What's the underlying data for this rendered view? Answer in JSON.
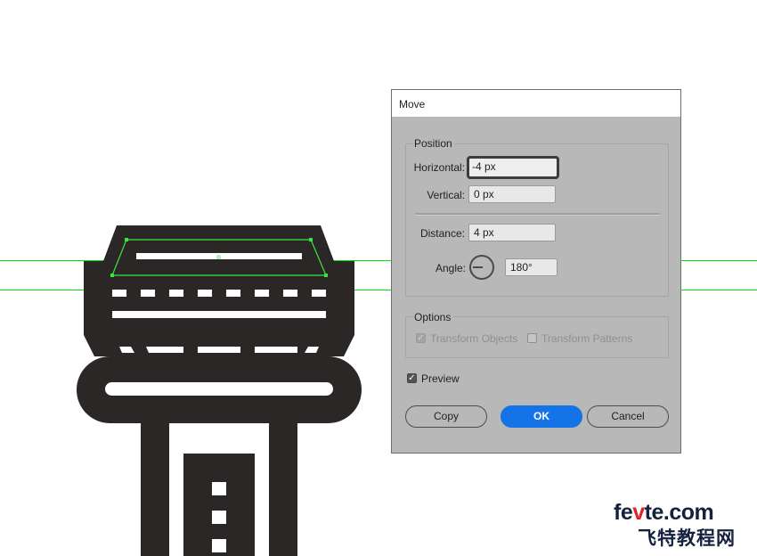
{
  "colors": {
    "artwork": "#2b2727",
    "guide": "#00e000",
    "selection": "#36e83c",
    "dialog_bg": "#b8b8b8",
    "primary_button": "#1473e6"
  },
  "dialog": {
    "title": "Move",
    "position_group": {
      "label": "Position",
      "horizontal_label": "Horizontal:",
      "horizontal_value": "-4 px",
      "vertical_label": "Vertical:",
      "vertical_value": "0 px",
      "distance_label": "Distance:",
      "distance_value": "4 px",
      "angle_label": "Angle:",
      "angle_value": "180°"
    },
    "options_group": {
      "label": "Options",
      "transform_objects_label": "Transform Objects",
      "transform_objects_checked": true,
      "transform_patterns_label": "Transform Patterns",
      "transform_patterns_checked": false
    },
    "preview_label": "Preview",
    "preview_checked": true,
    "copy_label": "Copy",
    "ok_label": "OK",
    "cancel_label": "Cancel"
  },
  "watermark": {
    "line1_a": "fe",
    "line1_accent": "v",
    "line1_b": "te.com",
    "line2": "飞特教程网"
  }
}
